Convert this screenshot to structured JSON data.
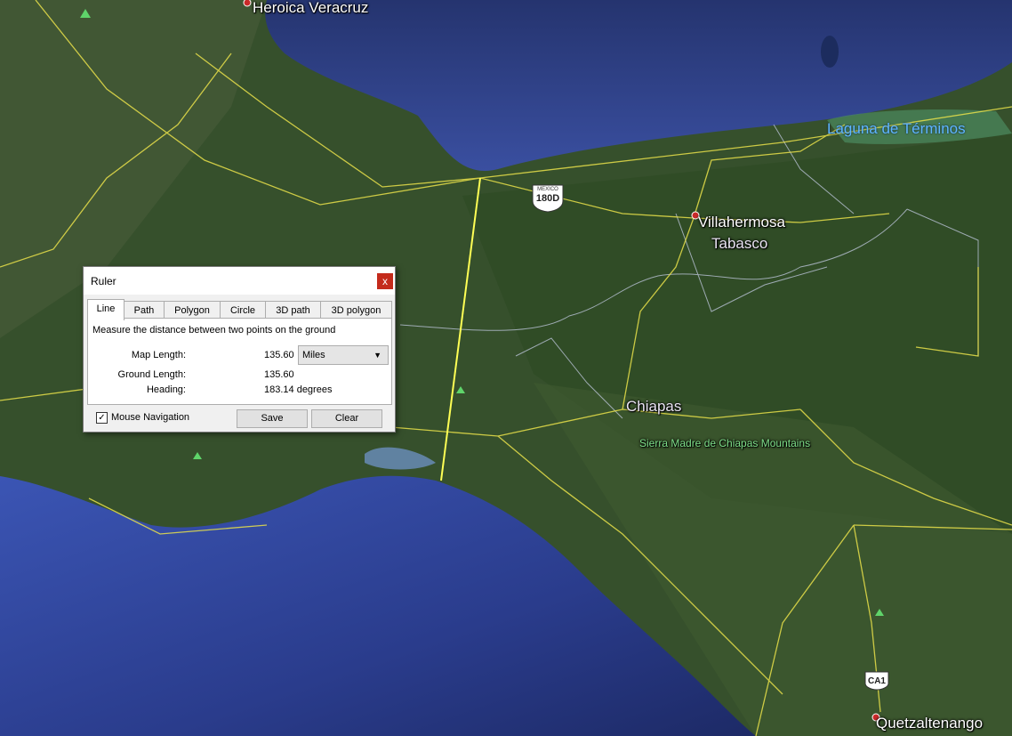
{
  "map_labels": {
    "veracruz": "Heroica Veracruz",
    "laguna": "Laguna de Términos",
    "villahermosa": "Villahermosa",
    "tabasco": "Tabasco",
    "chiapas": "Chiapas",
    "sierra": "Sierra Madre de Chiapas Mountains",
    "quetzaltenango": "Quetzaltenango",
    "shield_180d_top": "MEXICO",
    "shield_180d": "180D",
    "shield_ca1": "CA1"
  },
  "ruler": {
    "title": "Ruler",
    "close": "x",
    "tabs": [
      "Line",
      "Path",
      "Polygon",
      "Circle",
      "3D path",
      "3D polygon"
    ],
    "active_tab": "Line",
    "description": "Measure the distance between two points on the ground",
    "map_length_label": "Map Length:",
    "map_length_value": "135.60",
    "units": "Miles",
    "ground_length_label": "Ground Length:",
    "ground_length_value": "135.60",
    "heading_label": "Heading:",
    "heading_value": "183.14 degrees",
    "mouse_nav_label": "Mouse Navigation",
    "mouse_nav_checked": true,
    "save_label": "Save",
    "clear_label": "Clear"
  },
  "colors": {
    "ocean": "#2c3f86",
    "land": "#3a5530",
    "roads": "#e8e04a",
    "ruler_line": "#ffff55",
    "close_button": "#c42b1c"
  }
}
